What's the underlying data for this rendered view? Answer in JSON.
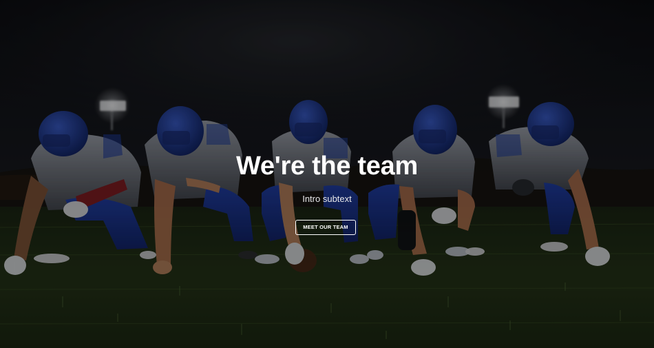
{
  "hero": {
    "title": "We're the team",
    "subtext": "Intro subtext",
    "cta_label": "MEET OUR TEAM",
    "background_image": "football-team-lineup-photo",
    "colors": {
      "text": "#ffffff",
      "jersey_blue": "#1f3fa8",
      "jersey_grey": "#b9bdc6",
      "turf": "#27361c"
    }
  }
}
